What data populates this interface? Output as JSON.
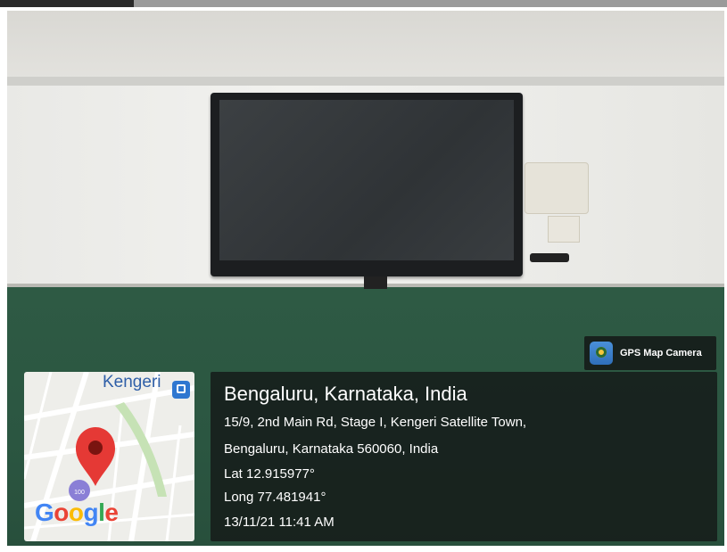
{
  "gps_badge": {
    "app_name": "GPS Map Camera",
    "icon": "gps-map-camera-icon"
  },
  "map": {
    "place_label": "Kengeri",
    "transit_icon": "bus-station-icon",
    "pin_icon": "map-pin-icon",
    "route_badge": "100",
    "provider": [
      "G",
      "o",
      "o",
      "g",
      "l",
      "e"
    ]
  },
  "location": {
    "title": "Bengaluru, Karnataka, India",
    "address_line1": "15/9, 2nd Main Rd, Stage I, Kengeri Satellite Town,",
    "address_line2": "Bengaluru, Karnataka 560060, India",
    "latitude": "Lat 12.915977°",
    "longitude": "Long 77.481941°",
    "timestamp": "13/11/21 11:41 AM"
  },
  "colors": {
    "overlay": "#161c1a",
    "pin": "#e53935",
    "map_label": "#2f5fa8",
    "board": "#2b5641"
  }
}
